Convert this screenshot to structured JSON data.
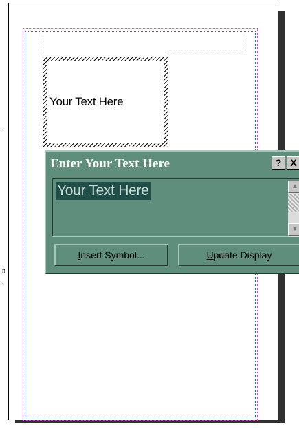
{
  "document": {
    "frame_text": "Your Text Here",
    "edge_marks": [
      ".",
      "n",
      "."
    ]
  },
  "dialog": {
    "title": "Enter Your Text Here",
    "help_label": "?",
    "close_label": "X",
    "text_value": "Your Text Here",
    "insert_symbol": {
      "mnemonic": "I",
      "rest": "nsert Symbol..."
    },
    "update_display": {
      "mnemonic": "U",
      "rest": "pdate Display"
    }
  },
  "colors": {
    "dialog_bg": "#5f8f7c",
    "selection_bg": "#1f4f48",
    "margin_pink": "#e040e0",
    "margin_blue": "#3060ff"
  },
  "icons": [
    "help-icon",
    "close-icon",
    "scroll-up-arrow-icon",
    "scroll-down-arrow-icon"
  ]
}
